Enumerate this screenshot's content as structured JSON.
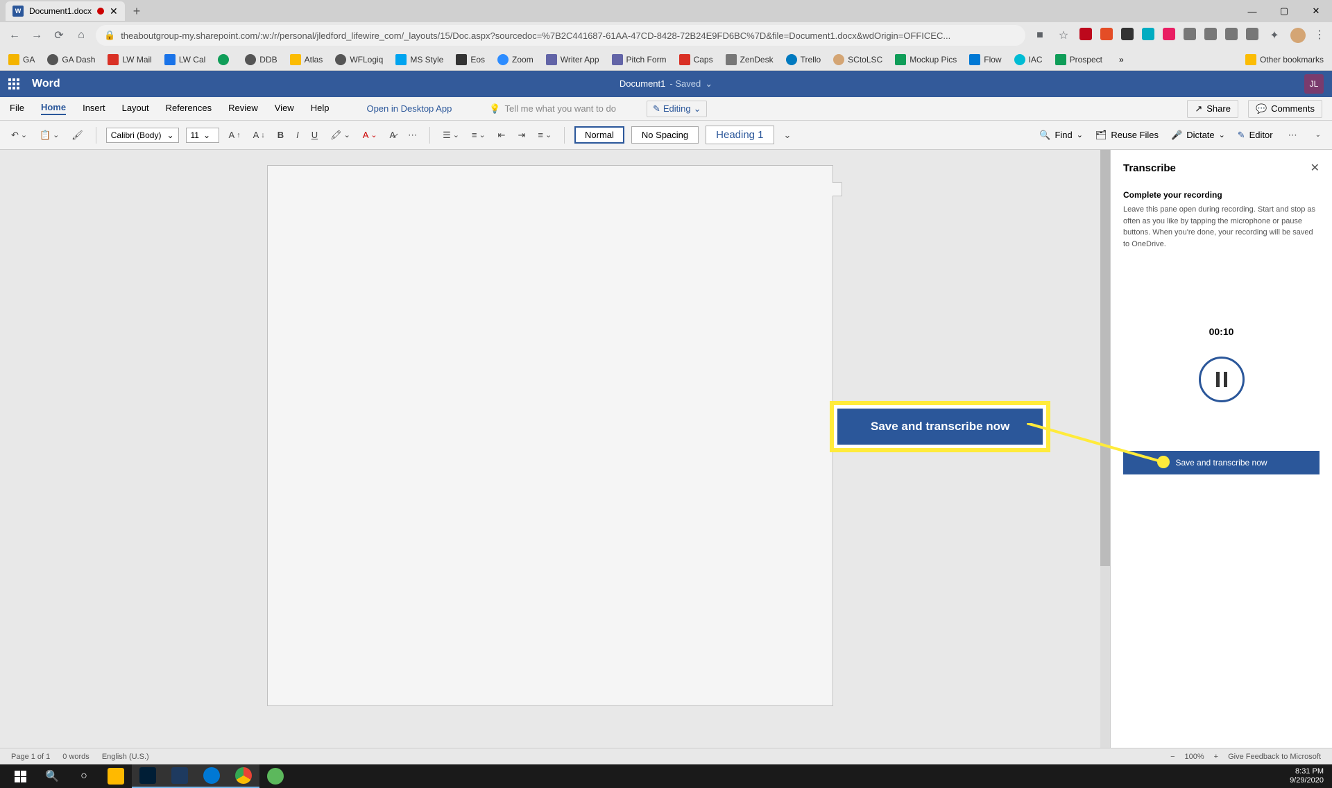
{
  "browser": {
    "tab_title": "Document1.docx",
    "window_controls": {
      "min": "—",
      "max": "▢",
      "close": "✕"
    },
    "url": "theaboutgroup-my.sharepoint.com/:w:/r/personal/jledford_lifewire_com/_layouts/15/Doc.aspx?sourcedoc=%7B2C441687-61AA-47CD-8428-72B24E9FD6BC%7D&file=Document1.docx&wdOrigin=OFFICEC..."
  },
  "bookmarks": [
    "GA",
    "GA Dash",
    "LW Mail",
    "LW Cal",
    "DDB",
    "Atlas",
    "WFLogiq",
    "MS Style",
    "Eos",
    "Zoom",
    "Writer App",
    "Pitch Form",
    "Caps",
    "ZenDesk",
    "Trello",
    "SCtoLSC",
    "Mockup Pics",
    "Flow",
    "IAC",
    "Prospect"
  ],
  "bookmarks_other": "Other bookmarks",
  "word": {
    "app": "Word",
    "doc_name": "Document1",
    "saved": "- Saved",
    "user_initials": "JL"
  },
  "ribbon": {
    "tabs": [
      "File",
      "Home",
      "Insert",
      "Layout",
      "References",
      "Review",
      "View",
      "Help"
    ],
    "open_desktop": "Open in Desktop App",
    "tell_me": "Tell me what you want to do",
    "editing": "Editing",
    "share": "Share",
    "comments": "Comments"
  },
  "toolbar": {
    "font": "Calibri (Body)",
    "size": "11",
    "styles": {
      "normal": "Normal",
      "no_spacing": "No Spacing",
      "heading1": "Heading 1"
    },
    "find": "Find",
    "reuse": "Reuse Files",
    "dictate": "Dictate",
    "editor": "Editor"
  },
  "transcribe": {
    "title": "Transcribe",
    "subtitle": "Complete your recording",
    "text": "Leave this pane open during recording. Start and stop as often as you like by tapping the microphone or pause buttons. When you're done, your recording will be saved to OneDrive.",
    "timer": "00:10",
    "save_btn": "Save and transcribe now"
  },
  "callout": {
    "label": "Save and transcribe now"
  },
  "status": {
    "page": "Page 1 of 1",
    "words": "0 words",
    "lang": "English (U.S.)",
    "zoom": "100%",
    "feedback": "Give Feedback to Microsoft"
  },
  "taskbar": {
    "time": "8:31 PM",
    "date": "9/29/2020"
  }
}
